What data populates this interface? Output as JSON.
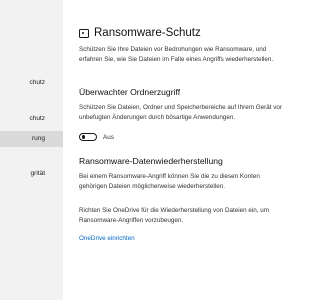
{
  "sidebar": {
    "items": [
      {
        "label": "chutz",
        "selected": false
      },
      {
        "label": "chutz",
        "selected": false
      },
      {
        "label": "rung",
        "selected": true
      },
      {
        "label": "grität",
        "selected": false
      }
    ]
  },
  "page": {
    "icon": "ransomware-protection-icon",
    "title": "Ransomware-Schutz",
    "description": "Schützen Sie Ihre Dateien vor Bedrohungen wie Ransomware, und\nerfahren Sie, wie Sie Dateien im Falle eines Angriffs wiederherstellen."
  },
  "controlled_folder_access": {
    "heading": "Überwachter Ordnerzugriff",
    "description": "Schützen Sie Dateien, Ordner und Speicherbereiche auf Ihrem Gerät vor\nunbefugten Änderungen durch bösartige Anwendungen.",
    "toggle_state": "off",
    "toggle_label": "Aus"
  },
  "ransomware_recovery": {
    "heading": "Ransomware-Datenwiederherstellung",
    "description": "Bei einem Ransomware-Angriff können Sie die zu diesen Konten\ngehörigen Dateien möglicherweise wiederherstellen.",
    "onedrive_text": "Richten Sie OneDrive für die Wiederherstellung von Dateien ein, um\nRansomware-Angriffen vorzubeugen.",
    "onedrive_link": "OneDrive einrichten"
  },
  "colors": {
    "sidebar_bg": "#f2f2f2",
    "selected_item_bg": "#d9d9d9",
    "link": "#0067c0"
  }
}
